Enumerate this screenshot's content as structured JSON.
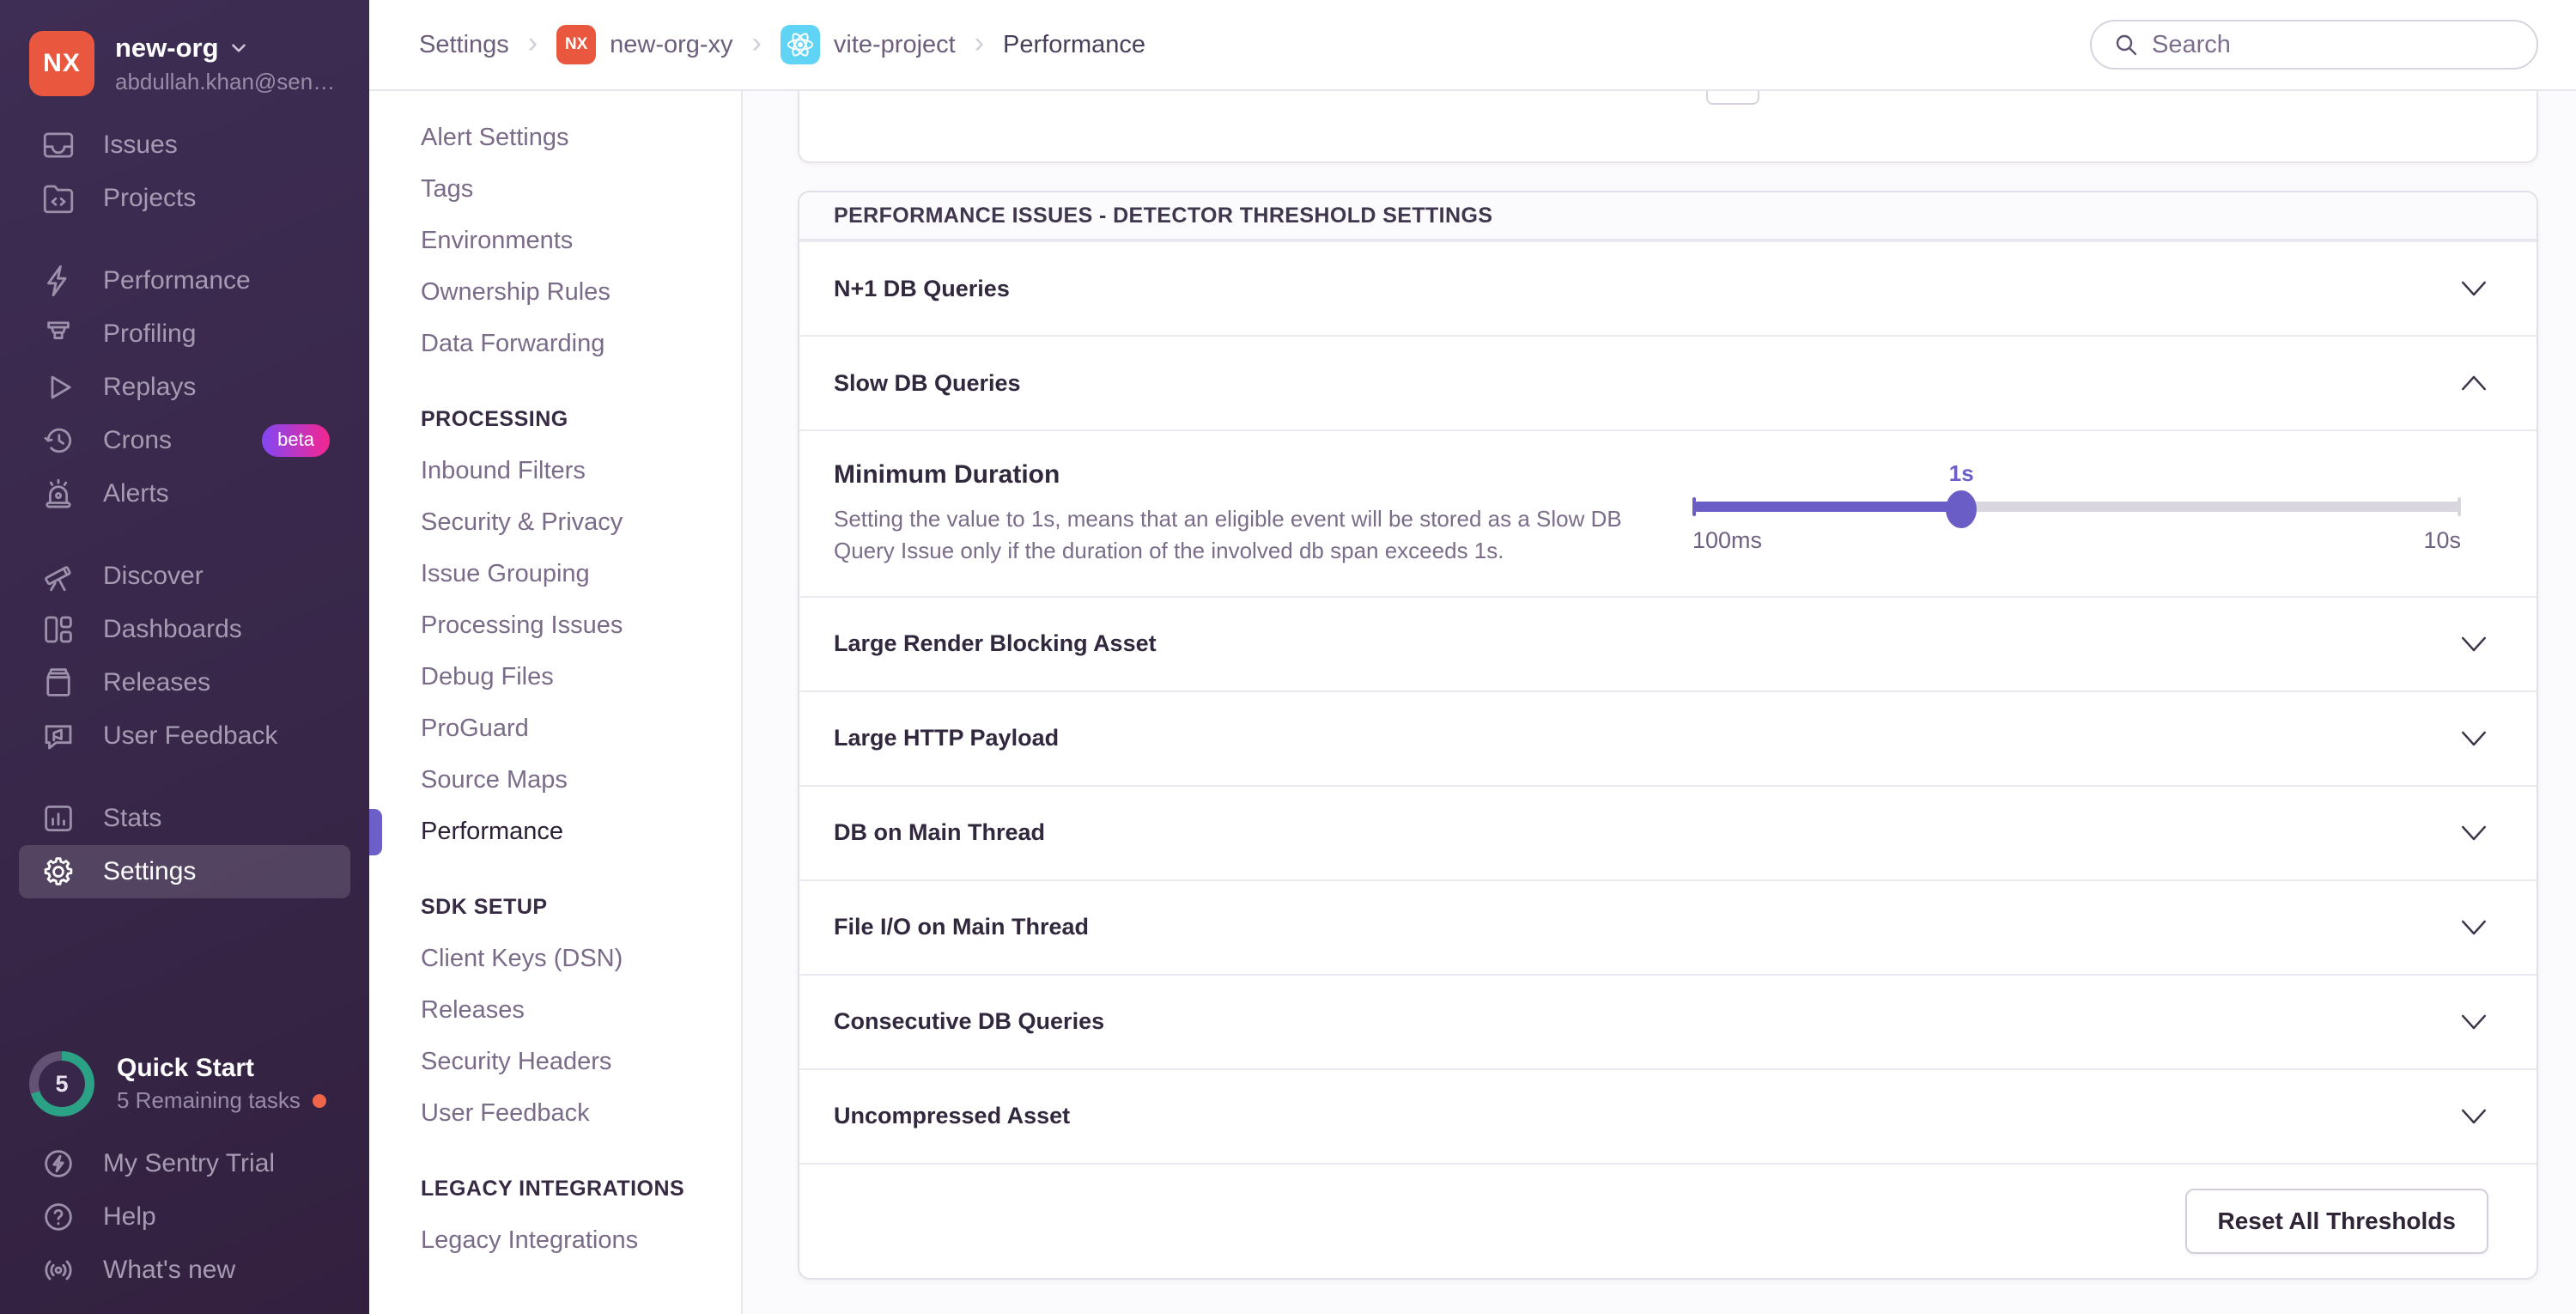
{
  "sidebar": {
    "org": {
      "initials": "NX",
      "name": "new-org",
      "email": "abdullah.khan@sen…"
    },
    "sections": [
      {
        "items": [
          {
            "icon": "issues-icon",
            "label": "Issues"
          },
          {
            "icon": "projects-icon",
            "label": "Projects"
          }
        ]
      },
      {
        "items": [
          {
            "icon": "performance-icon",
            "label": "Performance"
          },
          {
            "icon": "profiling-icon",
            "label": "Profiling"
          },
          {
            "icon": "replays-icon",
            "label": "Replays"
          },
          {
            "icon": "crons-icon",
            "label": "Crons",
            "badge": "beta"
          },
          {
            "icon": "alerts-icon",
            "label": "Alerts"
          }
        ]
      },
      {
        "items": [
          {
            "icon": "discover-icon",
            "label": "Discover"
          },
          {
            "icon": "dashboards-icon",
            "label": "Dashboards"
          },
          {
            "icon": "releases-icon",
            "label": "Releases"
          },
          {
            "icon": "user-feedback-icon",
            "label": "User Feedback"
          }
        ]
      },
      {
        "items": [
          {
            "icon": "stats-icon",
            "label": "Stats"
          },
          {
            "icon": "settings-icon",
            "label": "Settings",
            "active": true
          }
        ]
      }
    ],
    "quickstart": {
      "count": "5",
      "title": "Quick Start",
      "subtitle": "5 Remaining tasks"
    },
    "footer_items": [
      {
        "icon": "trial-icon",
        "label": "My Sentry Trial"
      },
      {
        "icon": "help-icon",
        "label": "Help"
      },
      {
        "icon": "whats-new-icon",
        "label": "What's new"
      }
    ]
  },
  "header": {
    "breadcrumbs": [
      {
        "label": "Settings"
      },
      {
        "label": "new-org-xy",
        "badge": "NX"
      },
      {
        "label": "vite-project",
        "badge": "react"
      },
      {
        "label": "Performance"
      }
    ],
    "search_placeholder": "Search"
  },
  "secondary_nav": {
    "groups": [
      {
        "header": "",
        "items": [
          {
            "label": "Alert Settings"
          },
          {
            "label": "Tags"
          },
          {
            "label": "Environments"
          },
          {
            "label": "Ownership Rules"
          },
          {
            "label": "Data Forwarding"
          }
        ]
      },
      {
        "header": "PROCESSING",
        "items": [
          {
            "label": "Inbound Filters"
          },
          {
            "label": "Security & Privacy"
          },
          {
            "label": "Issue Grouping"
          },
          {
            "label": "Processing Issues"
          },
          {
            "label": "Debug Files"
          },
          {
            "label": "ProGuard"
          },
          {
            "label": "Source Maps"
          },
          {
            "label": "Performance",
            "active": true
          }
        ]
      },
      {
        "header": "SDK SETUP",
        "items": [
          {
            "label": "Client Keys (DSN)"
          },
          {
            "label": "Releases"
          },
          {
            "label": "Security Headers"
          },
          {
            "label": "User Feedback"
          }
        ]
      },
      {
        "header": "LEGACY INTEGRATIONS",
        "items": [
          {
            "label": "Legacy Integrations"
          }
        ]
      }
    ]
  },
  "main": {
    "panel_title": "PERFORMANCE ISSUES - DETECTOR THRESHOLD SETTINGS",
    "rows": [
      {
        "label": "N+1 DB Queries",
        "expanded": false
      },
      {
        "label": "Slow DB Queries",
        "expanded": true
      },
      {
        "label": "Large Render Blocking Asset",
        "expanded": false
      },
      {
        "label": "Large HTTP Payload",
        "expanded": false
      },
      {
        "label": "DB on Main Thread",
        "expanded": false
      },
      {
        "label": "File I/O on Main Thread",
        "expanded": false
      },
      {
        "label": "Consecutive DB Queries",
        "expanded": false
      },
      {
        "label": "Uncompressed Asset",
        "expanded": false
      }
    ],
    "expanded": {
      "setting_label": "Minimum Duration",
      "setting_description": "Setting the value to 1s, means that an eligible event will be stored as a Slow DB Query Issue only if the duration of the involved db span exceeds 1s.",
      "slider": {
        "value_label": "1s",
        "min_label": "100ms",
        "max_label": "10s",
        "percent": 35
      }
    },
    "reset_button": "Reset All Thresholds"
  },
  "colors": {
    "accent_purple": "#6c5fc7",
    "sidebar_bg": "#382749",
    "org_avatar_orange": "#e9573f",
    "beta_gradient_start": "#8247f5",
    "beta_gradient_end": "#f4268f",
    "quickstart_teal": "#2ba185",
    "notification_dot_orange": "#ee6549",
    "react_badge_cyan": "#5fd4f4"
  }
}
